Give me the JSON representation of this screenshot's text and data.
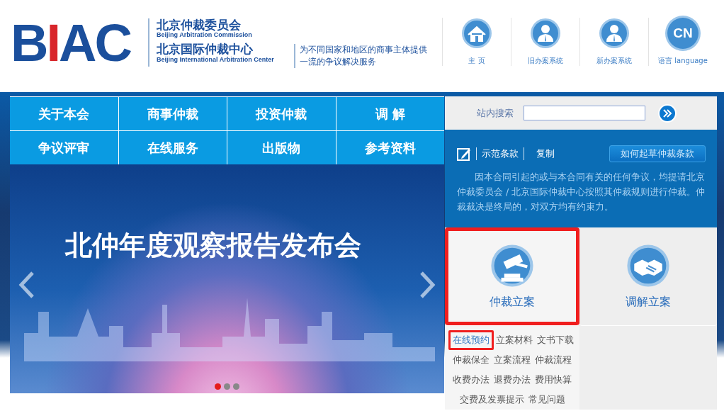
{
  "header": {
    "logo_letters": [
      {
        "text": "B",
        "color": "#1b4f9c"
      },
      {
        "text": "I",
        "color": "#d8262b"
      },
      {
        "text": "A",
        "color": "#1b4f9c"
      },
      {
        "text": "C",
        "color": "#1b4f9c"
      }
    ],
    "org_names": [
      {
        "cn": "北京仲裁委员会",
        "en": "Beijing Arbitration Commission"
      },
      {
        "cn": "北京国际仲裁中心",
        "en": "Beijing International Arbitration Center"
      }
    ],
    "tagline_lines": [
      "为不同国家和地区的商事主体提供",
      "一流的争议解决服务"
    ],
    "links": [
      {
        "kind": "home",
        "label": "主 页"
      },
      {
        "kind": "person",
        "label": "旧办案系统"
      },
      {
        "kind": "person",
        "label": "新办案系统"
      },
      {
        "kind": "text",
        "icon_text": "CN",
        "label": "语言 language"
      }
    ]
  },
  "nav": [
    "关于本会",
    "商事仲裁",
    "投资仲裁",
    "调 解",
    "争议评审",
    "在线服务",
    "出版物",
    "参考资料"
  ],
  "banner": {
    "title": "北仲年度观察报告发布会",
    "dots": [
      {
        "selected": true
      },
      {
        "selected": false
      },
      {
        "selected": false
      }
    ]
  },
  "search": {
    "label": "站内搜索"
  },
  "clause": {
    "tab": "示范条款",
    "copy": "复制",
    "button": "如何起草仲裁条款",
    "text": "因本合同引起的或与本合同有关的任何争议，均提请北京仲裁委员会 / 北京国际仲裁中心按照其仲裁规则进行仲裁。仲裁裁决是终局的，对双方均有约束力。"
  },
  "tiles": [
    {
      "kind": "gavel",
      "label": "仲裁立案",
      "highlighted": true
    },
    {
      "kind": "handshake",
      "label": "调解立案",
      "highlighted": false
    }
  ],
  "quick_links": [
    [
      {
        "label": "在线预约",
        "highlighted": true
      },
      {
        "label": "立案材料",
        "highlighted": false
      },
      {
        "label": "文书下载",
        "highlighted": false
      }
    ],
    [
      {
        "label": "仲裁保全",
        "highlighted": false
      },
      {
        "label": "立案流程",
        "highlighted": false
      },
      {
        "label": "仲裁流程",
        "highlighted": false
      }
    ],
    [
      {
        "label": "收费办法",
        "highlighted": false
      },
      {
        "label": "退费办法",
        "highlighted": false
      },
      {
        "label": "费用快算",
        "highlighted": false
      }
    ],
    [
      {
        "label": "交费及发票提示",
        "highlighted": false
      },
      {
        "label": "常见问题",
        "highlighted": false
      }
    ]
  ]
}
